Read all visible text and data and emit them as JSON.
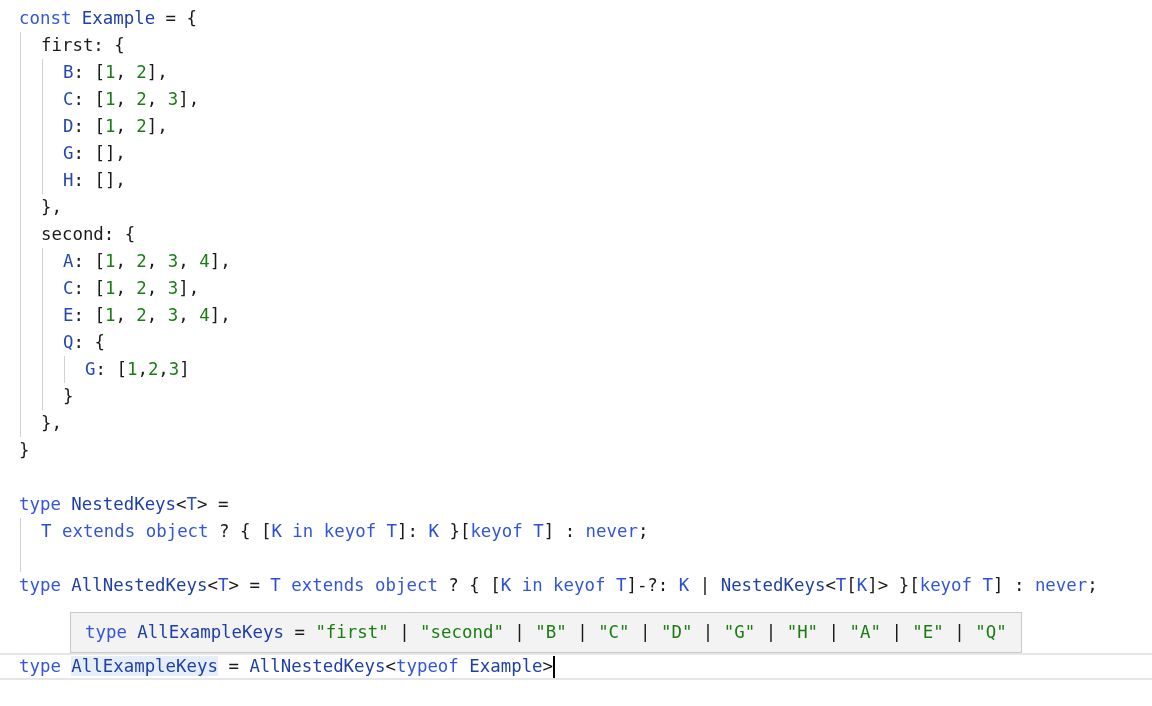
{
  "editor": {
    "lines": [
      {
        "kind": "code",
        "tokens": [
          {
            "kind": "keyword",
            "text": "const"
          },
          {
            "kind": "identifier",
            "text": " Example"
          },
          {
            "kind": "plain",
            "text": " = {"
          }
        ],
        "children": [
          {
            "kind": "code",
            "tokens": [
              {
                "kind": "plain",
                "text": "first: {"
              }
            ],
            "children": [
              {
                "kind": "code",
                "tokens": [
                  {
                    "kind": "property",
                    "text": "B"
                  },
                  {
                    "kind": "plain",
                    "text": ": ["
                  },
                  {
                    "kind": "number",
                    "text": "1"
                  },
                  {
                    "kind": "plain",
                    "text": ", "
                  },
                  {
                    "kind": "number",
                    "text": "2"
                  },
                  {
                    "kind": "plain",
                    "text": "],"
                  }
                ]
              },
              {
                "kind": "code",
                "tokens": [
                  {
                    "kind": "property",
                    "text": "C"
                  },
                  {
                    "kind": "plain",
                    "text": ": ["
                  },
                  {
                    "kind": "number",
                    "text": "1"
                  },
                  {
                    "kind": "plain",
                    "text": ", "
                  },
                  {
                    "kind": "number",
                    "text": "2"
                  },
                  {
                    "kind": "plain",
                    "text": ", "
                  },
                  {
                    "kind": "number",
                    "text": "3"
                  },
                  {
                    "kind": "plain",
                    "text": "],"
                  }
                ]
              },
              {
                "kind": "code",
                "tokens": [
                  {
                    "kind": "property",
                    "text": "D"
                  },
                  {
                    "kind": "plain",
                    "text": ": ["
                  },
                  {
                    "kind": "number",
                    "text": "1"
                  },
                  {
                    "kind": "plain",
                    "text": ", "
                  },
                  {
                    "kind": "number",
                    "text": "2"
                  },
                  {
                    "kind": "plain",
                    "text": "],"
                  }
                ]
              },
              {
                "kind": "code",
                "tokens": [
                  {
                    "kind": "property",
                    "text": "G"
                  },
                  {
                    "kind": "plain",
                    "text": ": [],"
                  }
                ]
              },
              {
                "kind": "code",
                "tokens": [
                  {
                    "kind": "property",
                    "text": "H"
                  },
                  {
                    "kind": "plain",
                    "text": ": [],"
                  }
                ]
              }
            ]
          },
          {
            "kind": "code",
            "tokens": [
              {
                "kind": "plain",
                "text": "},"
              }
            ]
          },
          {
            "kind": "code",
            "tokens": [
              {
                "kind": "plain",
                "text": "second: {"
              }
            ],
            "children": [
              {
                "kind": "code",
                "tokens": [
                  {
                    "kind": "property",
                    "text": "A"
                  },
                  {
                    "kind": "plain",
                    "text": ": ["
                  },
                  {
                    "kind": "number",
                    "text": "1"
                  },
                  {
                    "kind": "plain",
                    "text": ", "
                  },
                  {
                    "kind": "number",
                    "text": "2"
                  },
                  {
                    "kind": "plain",
                    "text": ", "
                  },
                  {
                    "kind": "number",
                    "text": "3"
                  },
                  {
                    "kind": "plain",
                    "text": ", "
                  },
                  {
                    "kind": "number",
                    "text": "4"
                  },
                  {
                    "kind": "plain",
                    "text": "],"
                  }
                ]
              },
              {
                "kind": "code",
                "tokens": [
                  {
                    "kind": "property",
                    "text": "C"
                  },
                  {
                    "kind": "plain",
                    "text": ": ["
                  },
                  {
                    "kind": "number",
                    "text": "1"
                  },
                  {
                    "kind": "plain",
                    "text": ", "
                  },
                  {
                    "kind": "number",
                    "text": "2"
                  },
                  {
                    "kind": "plain",
                    "text": ", "
                  },
                  {
                    "kind": "number",
                    "text": "3"
                  },
                  {
                    "kind": "plain",
                    "text": "],"
                  }
                ]
              },
              {
                "kind": "code",
                "tokens": [
                  {
                    "kind": "property",
                    "text": "E"
                  },
                  {
                    "kind": "plain",
                    "text": ": ["
                  },
                  {
                    "kind": "number",
                    "text": "1"
                  },
                  {
                    "kind": "plain",
                    "text": ", "
                  },
                  {
                    "kind": "number",
                    "text": "2"
                  },
                  {
                    "kind": "plain",
                    "text": ", "
                  },
                  {
                    "kind": "number",
                    "text": "3"
                  },
                  {
                    "kind": "plain",
                    "text": ", "
                  },
                  {
                    "kind": "number",
                    "text": "4"
                  },
                  {
                    "kind": "plain",
                    "text": "],"
                  }
                ]
              },
              {
                "kind": "code",
                "tokens": [
                  {
                    "kind": "property",
                    "text": "Q"
                  },
                  {
                    "kind": "plain",
                    "text": ": {"
                  }
                ],
                "children": [
                  {
                    "kind": "code",
                    "tokens": [
                      {
                        "kind": "property",
                        "text": "G"
                      },
                      {
                        "kind": "plain",
                        "text": ": ["
                      },
                      {
                        "kind": "number",
                        "text": "1"
                      },
                      {
                        "kind": "plain",
                        "text": ","
                      },
                      {
                        "kind": "number",
                        "text": "2"
                      },
                      {
                        "kind": "plain",
                        "text": ","
                      },
                      {
                        "kind": "number",
                        "text": "3"
                      },
                      {
                        "kind": "plain",
                        "text": "]"
                      }
                    ]
                  }
                ]
              },
              {
                "kind": "code",
                "tokens": [
                  {
                    "kind": "plain",
                    "text": "}"
                  }
                ]
              }
            ]
          },
          {
            "kind": "code",
            "tokens": [
              {
                "kind": "plain",
                "text": "},"
              }
            ]
          }
        ]
      },
      {
        "kind": "code",
        "tokens": [
          {
            "kind": "plain",
            "text": "}"
          }
        ]
      },
      {
        "kind": "blank"
      },
      {
        "kind": "code",
        "tokens": [
          {
            "kind": "keyword",
            "text": "type"
          },
          {
            "kind": "identifier",
            "text": " NestedKeys"
          },
          {
            "kind": "plain",
            "text": "<"
          },
          {
            "kind": "param",
            "text": "T"
          },
          {
            "kind": "plain",
            "text": "> ="
          }
        ],
        "children": [
          {
            "kind": "code",
            "tokens": [
              {
                "kind": "param",
                "text": "T"
              },
              {
                "kind": "keyword",
                "text": " extends"
              },
              {
                "kind": "keyword",
                "text": " object"
              },
              {
                "kind": "plain",
                "text": " ? { ["
              },
              {
                "kind": "param",
                "text": "K"
              },
              {
                "kind": "keyword",
                "text": " in"
              },
              {
                "kind": "keyword",
                "text": " keyof"
              },
              {
                "kind": "param",
                "text": " T"
              },
              {
                "kind": "plain",
                "text": "]: "
              },
              {
                "kind": "param",
                "text": "K"
              },
              {
                "kind": "plain",
                "text": " }["
              },
              {
                "kind": "keyword",
                "text": "keyof"
              },
              {
                "kind": "param",
                "text": " T"
              },
              {
                "kind": "plain",
                "text": "] : "
              },
              {
                "kind": "keyword",
                "text": "never"
              },
              {
                "kind": "plain",
                "text": ";"
              }
            ]
          },
          {
            "kind": "blank"
          }
        ]
      },
      {
        "kind": "code",
        "tokens": [
          {
            "kind": "keyword",
            "text": "type"
          },
          {
            "kind": "identifier",
            "text": " AllNestedKeys"
          },
          {
            "kind": "plain",
            "text": "<"
          },
          {
            "kind": "param",
            "text": "T"
          },
          {
            "kind": "plain",
            "text": "> = "
          },
          {
            "kind": "param",
            "text": "T"
          },
          {
            "kind": "keyword",
            "text": " extends"
          },
          {
            "kind": "keyword",
            "text": " object"
          },
          {
            "kind": "plain",
            "text": " ? { ["
          },
          {
            "kind": "param",
            "text": "K"
          },
          {
            "kind": "keyword",
            "text": " in"
          },
          {
            "kind": "keyword",
            "text": " keyof"
          },
          {
            "kind": "param",
            "text": " T"
          },
          {
            "kind": "plain",
            "text": "]-?: "
          },
          {
            "kind": "param",
            "text": "K"
          },
          {
            "kind": "plain",
            "text": " | "
          },
          {
            "kind": "identifier",
            "text": "NestedKeys"
          },
          {
            "kind": "plain",
            "text": "<"
          },
          {
            "kind": "param",
            "text": "T"
          },
          {
            "kind": "plain",
            "text": "["
          },
          {
            "kind": "param",
            "text": "K"
          },
          {
            "kind": "plain",
            "text": "]> }["
          },
          {
            "kind": "keyword",
            "text": "keyof"
          },
          {
            "kind": "param",
            "text": " T"
          },
          {
            "kind": "plain",
            "text": "] : "
          },
          {
            "kind": "keyword",
            "text": "never"
          },
          {
            "kind": "plain",
            "text": ";"
          }
        ]
      },
      {
        "kind": "blank"
      },
      {
        "kind": "blank"
      },
      {
        "kind": "code",
        "current": true,
        "cursor": true,
        "tokens": [
          {
            "kind": "keyword",
            "text": "type "
          },
          {
            "kind": "identifier",
            "text": "AllExampleKeys",
            "highlighted": true
          },
          {
            "kind": "plain",
            "text": " = "
          },
          {
            "kind": "identifier",
            "text": "AllNestedKeys"
          },
          {
            "kind": "plain",
            "text": "<"
          },
          {
            "kind": "keyword",
            "text": "typeof"
          },
          {
            "kind": "identifier",
            "text": " Example"
          },
          {
            "kind": "plain",
            "text": ">"
          }
        ]
      }
    ]
  },
  "hover_tooltip": {
    "tokens": [
      {
        "kind": "keyword",
        "text": "type"
      },
      {
        "kind": "identifier",
        "text": " AllExampleKeys"
      },
      {
        "kind": "plain",
        "text": " = "
      },
      {
        "kind": "string",
        "text": "\"first\""
      },
      {
        "kind": "plain",
        "text": " | "
      },
      {
        "kind": "string",
        "text": "\"second\""
      },
      {
        "kind": "plain",
        "text": " | "
      },
      {
        "kind": "string",
        "text": "\"B\""
      },
      {
        "kind": "plain",
        "text": " | "
      },
      {
        "kind": "string",
        "text": "\"C\""
      },
      {
        "kind": "plain",
        "text": " | "
      },
      {
        "kind": "string",
        "text": "\"D\""
      },
      {
        "kind": "plain",
        "text": " | "
      },
      {
        "kind": "string",
        "text": "\"G\""
      },
      {
        "kind": "plain",
        "text": " | "
      },
      {
        "kind": "string",
        "text": "\"H\""
      },
      {
        "kind": "plain",
        "text": " | "
      },
      {
        "kind": "string",
        "text": "\"A\""
      },
      {
        "kind": "plain",
        "text": " | "
      },
      {
        "kind": "string",
        "text": "\"E\""
      },
      {
        "kind": "plain",
        "text": " | "
      },
      {
        "kind": "string",
        "text": "\"Q\""
      }
    ]
  }
}
